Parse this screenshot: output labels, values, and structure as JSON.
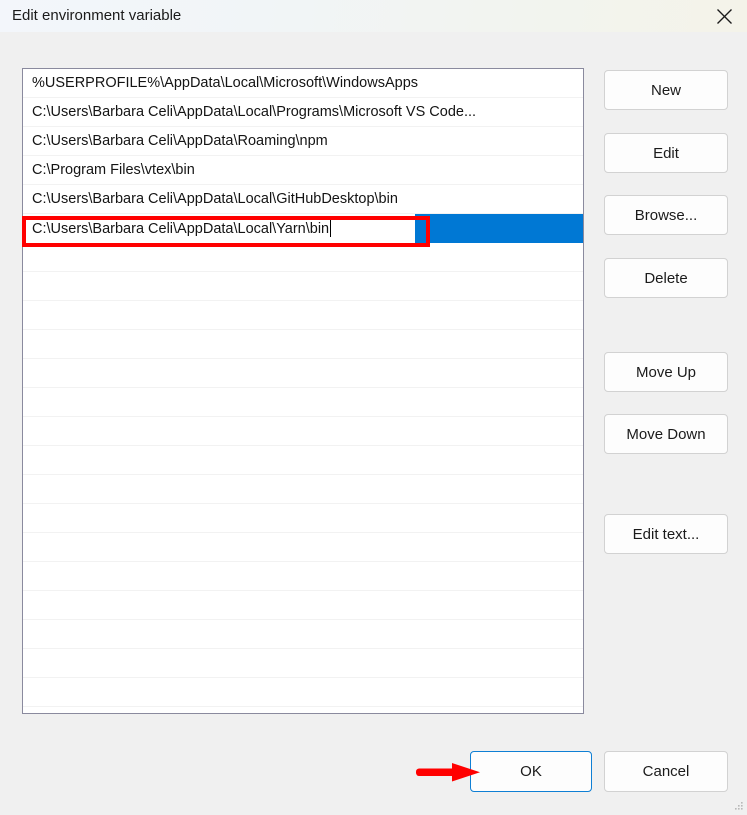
{
  "window": {
    "title": "Edit environment variable",
    "close_icon": "close-x-icon"
  },
  "list": {
    "rows": [
      {
        "text": "%USERPROFILE%\\AppData\\Local\\Microsoft\\WindowsApps",
        "selected": false
      },
      {
        "text": "C:\\Users\\Barbara Celi\\AppData\\Local\\Programs\\Microsoft VS Code...",
        "selected": false
      },
      {
        "text": "C:\\Users\\Barbara Celi\\AppData\\Roaming\\npm",
        "selected": false
      },
      {
        "text": "C:\\Program Files\\vtex\\bin",
        "selected": false
      },
      {
        "text": "C:\\Users\\Barbara Celi\\AppData\\Local\\GitHubDesktop\\bin",
        "selected": false
      }
    ],
    "editing_row": {
      "text": "C:\\Users\\Barbara Celi\\AppData\\Local\\Yarn\\bin",
      "selected": true,
      "in_edit_mode": true
    },
    "empty_row_count": 16,
    "selection_color": "#0078d4"
  },
  "side_buttons": [
    {
      "id": "new",
      "label": "New"
    },
    {
      "id": "edit",
      "label": "Edit"
    },
    {
      "id": "browse",
      "label": "Browse..."
    },
    {
      "id": "delete",
      "label": "Delete"
    },
    {
      "id": "move-up",
      "label": "Move Up"
    },
    {
      "id": "move-down",
      "label": "Move Down"
    },
    {
      "id": "edit-text",
      "label": "Edit text..."
    }
  ],
  "footer": {
    "ok_label": "OK",
    "cancel_label": "Cancel",
    "focused_button": "OK"
  },
  "annotations": {
    "highlight_rect_color": "#ff0000",
    "arrow_color": "#ff0000",
    "arrow_points_to": "OK"
  }
}
